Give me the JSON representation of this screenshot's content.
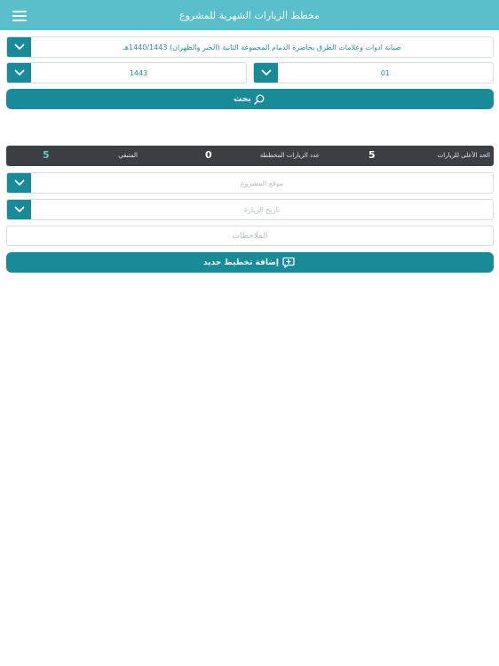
{
  "header": {
    "title": "مخطط الزيارات الشهرية للمشروع"
  },
  "filters": {
    "project": "صيانة ادوات وعلامات الطرق بحاضرة الدمام المجموعة الثانية (الخبر والظهران) 1440/1443هـ",
    "year": "1443",
    "month": "01"
  },
  "search_button": {
    "label": "بحث"
  },
  "stats": {
    "max_visits_label": "الحد الأعلى للزيارات",
    "max_visits_value": "5",
    "planned_visits_label": "عدد الزيارات المخططة",
    "planned_visits_value": "0",
    "remaining_label": "المتبقي",
    "remaining_value": "5",
    "remaining_color": "#5bd3c0"
  },
  "form": {
    "location_placeholder": "موقع المشروع",
    "visit_date_placeholder": "تاريخ الزيارة",
    "notes_placeholder": "الملاحظات"
  },
  "add_button": {
    "label": "إضافة تخطيط جديد"
  }
}
